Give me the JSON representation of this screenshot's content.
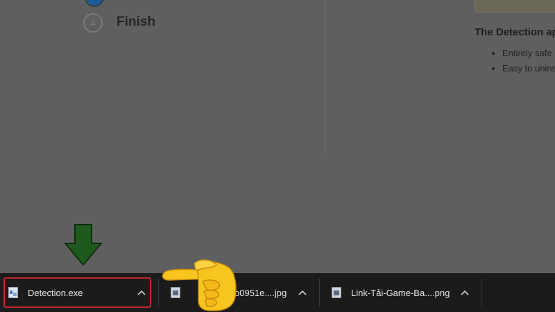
{
  "page": {
    "step_4_number": "4",
    "step_4_label": "Finish",
    "side_heading": "The Detection ap",
    "bullets": [
      "Entirely safe",
      "Easy to unins"
    ]
  },
  "downloads_bar": {
    "items": [
      {
        "name": "Detection.exe",
        "icon": "exe-file-icon"
      },
      {
        "name": "b0951e....jpg",
        "icon": "image-file-icon"
      },
      {
        "name": "Link-Tải-Game-Ba....png",
        "icon": "image-file-icon"
      }
    ]
  },
  "annotations": {
    "arrow": "down-arrow-icon",
    "hand": "pointing-hand-icon",
    "colors": {
      "highlight": "#c1272d",
      "arrow": "#1e5a1e",
      "hand": "#f7c51e"
    }
  }
}
